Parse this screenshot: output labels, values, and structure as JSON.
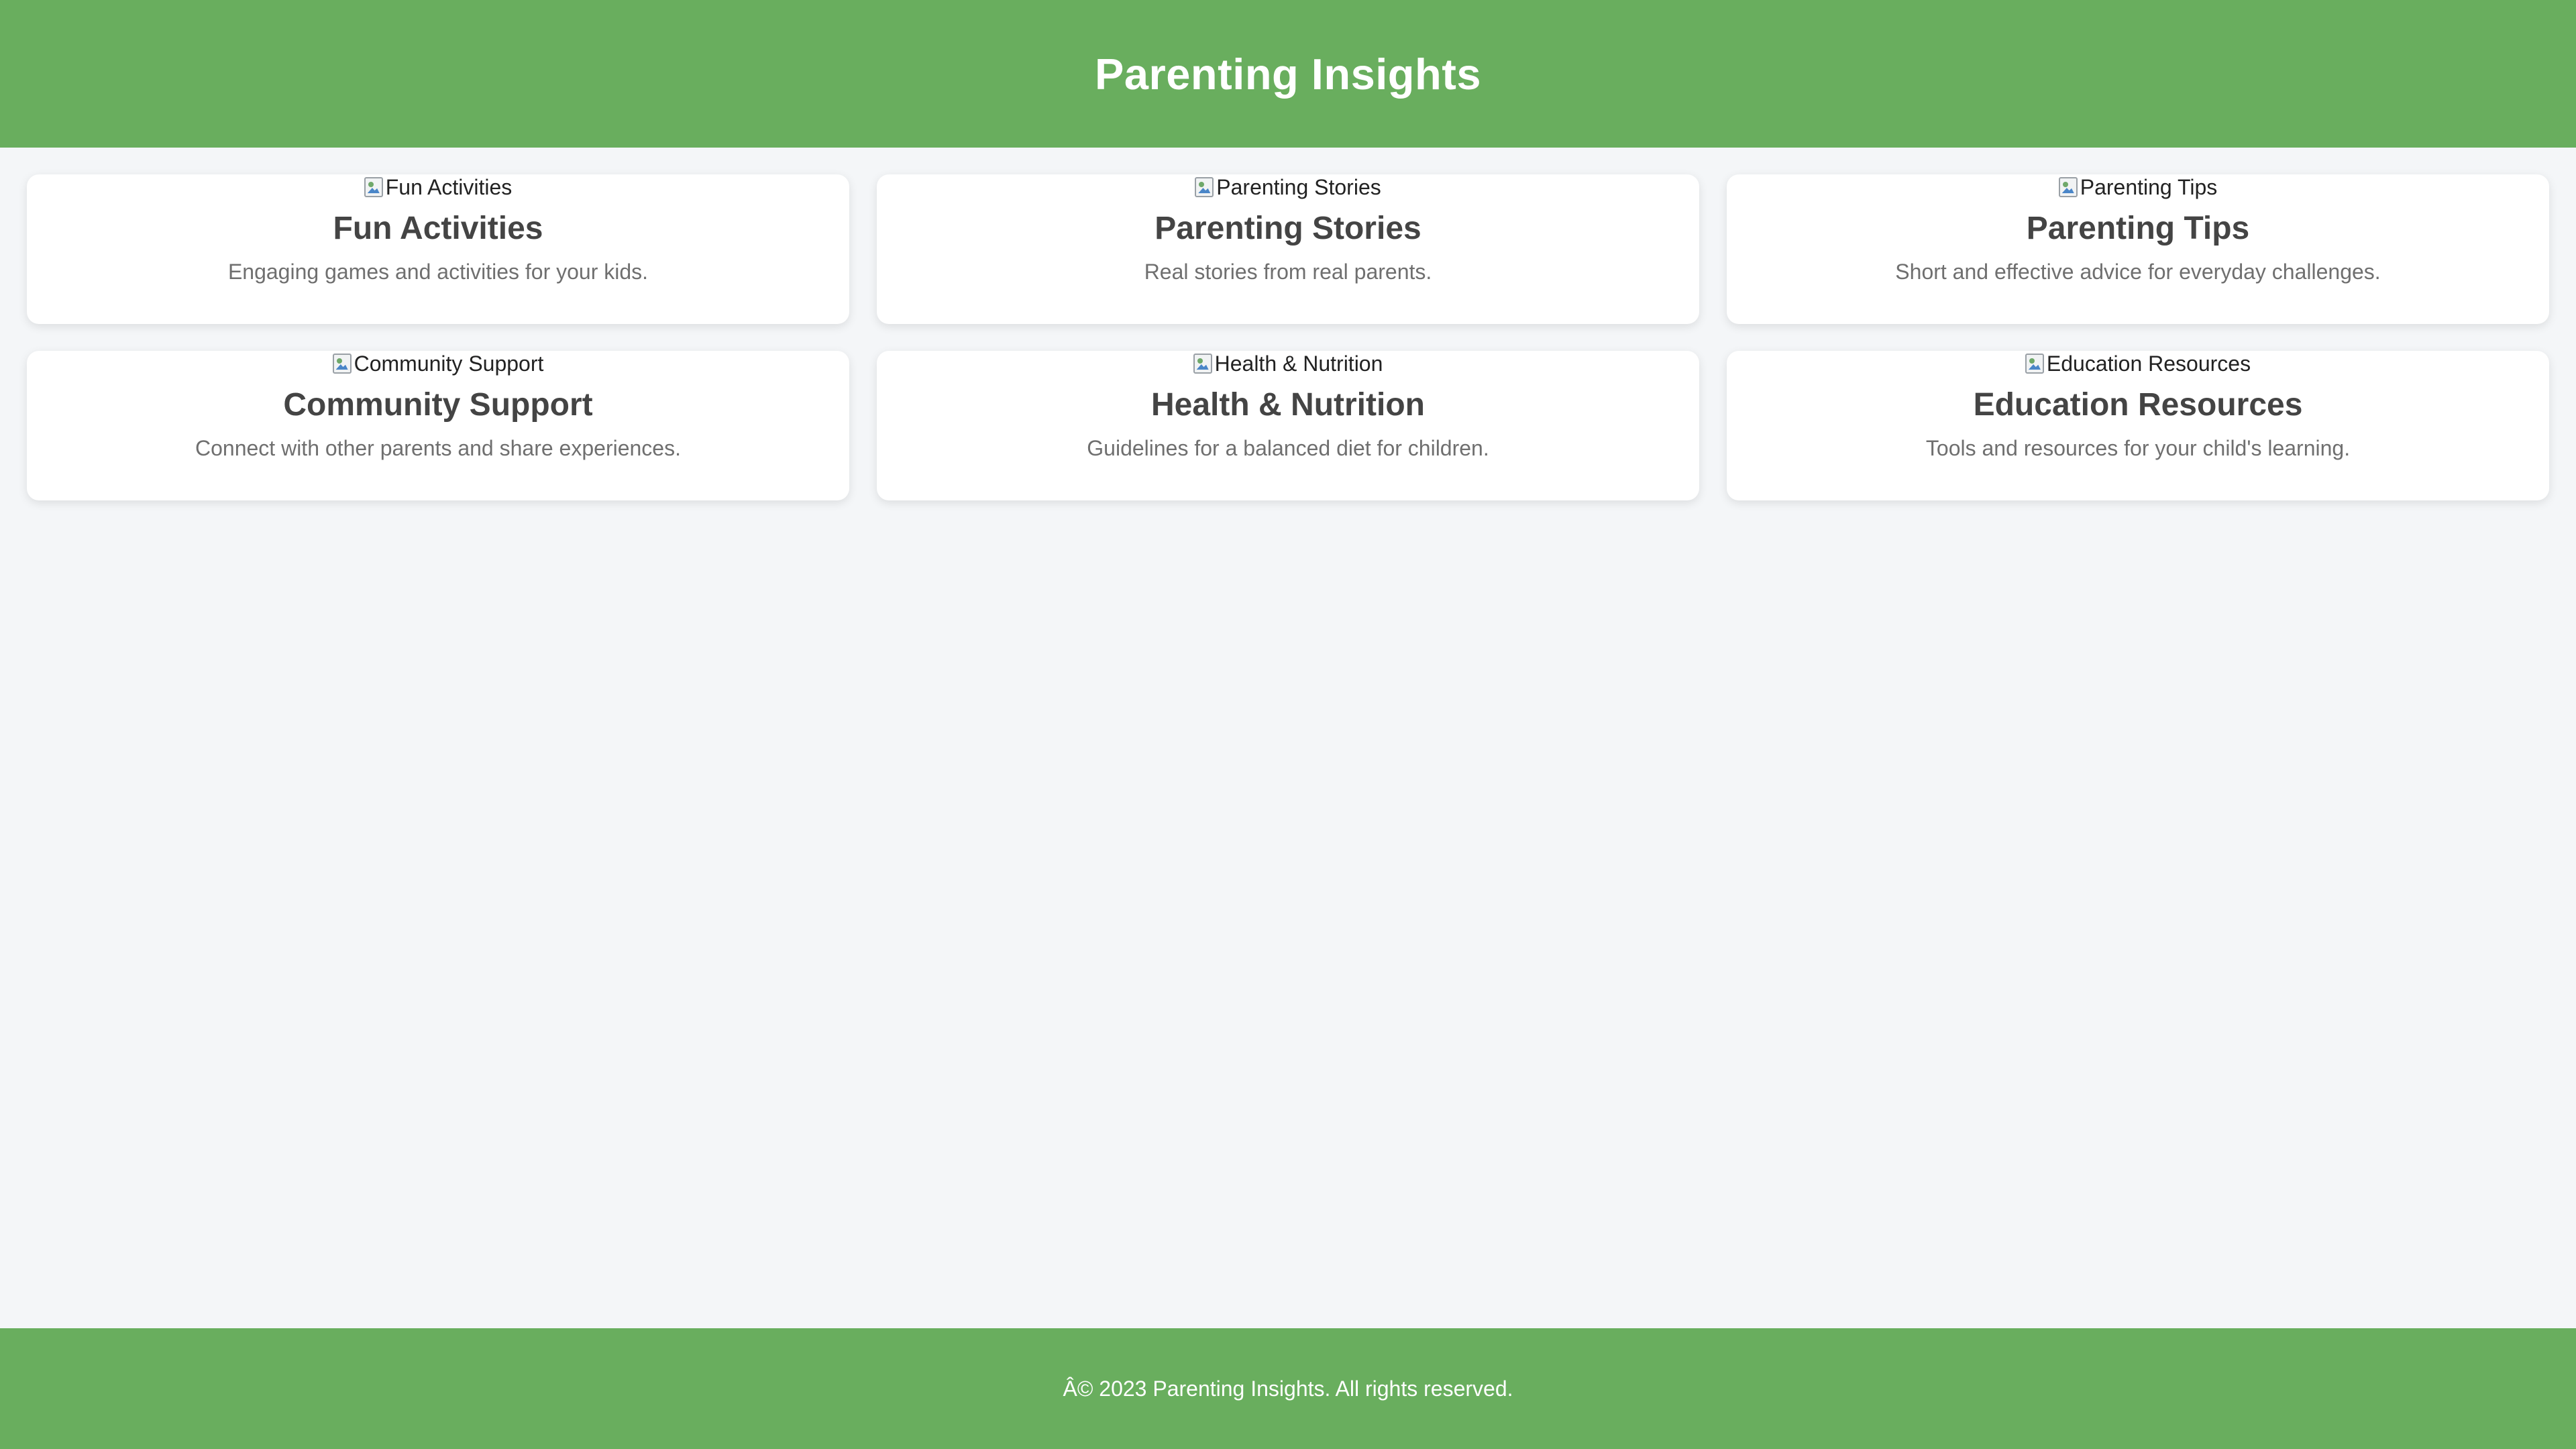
{
  "header": {
    "title": "Parenting Insights",
    "background_color": "#69ae5e"
  },
  "cards": [
    {
      "image_alt": "Fun Activities",
      "title": "Fun Activities",
      "description": "Engaging games and activities for your kids."
    },
    {
      "image_alt": "Parenting Stories",
      "title": "Parenting Stories",
      "description": "Real stories from real parents."
    },
    {
      "image_alt": "Parenting Tips",
      "title": "Parenting Tips",
      "description": "Short and effective advice for everyday challenges."
    },
    {
      "image_alt": "Community Support",
      "title": "Community Support",
      "description": "Connect with other parents and share experiences."
    },
    {
      "image_alt": "Health & Nutrition",
      "title": "Health & Nutrition",
      "description": "Guidelines for a balanced diet for children."
    },
    {
      "image_alt": "Education Resources",
      "title": "Education Resources",
      "description": "Tools and resources for your child's learning."
    }
  ],
  "footer": {
    "text": "Â© 2023 Parenting Insights. All rights reserved.",
    "background_color": "#69ae5e"
  },
  "colors": {
    "page_background": "#f4f6f8",
    "card_background": "#ffffff",
    "title_text": "#444444",
    "description_text": "#6f6f6f"
  },
  "icons": {
    "card_image": "broken-image-icon"
  }
}
